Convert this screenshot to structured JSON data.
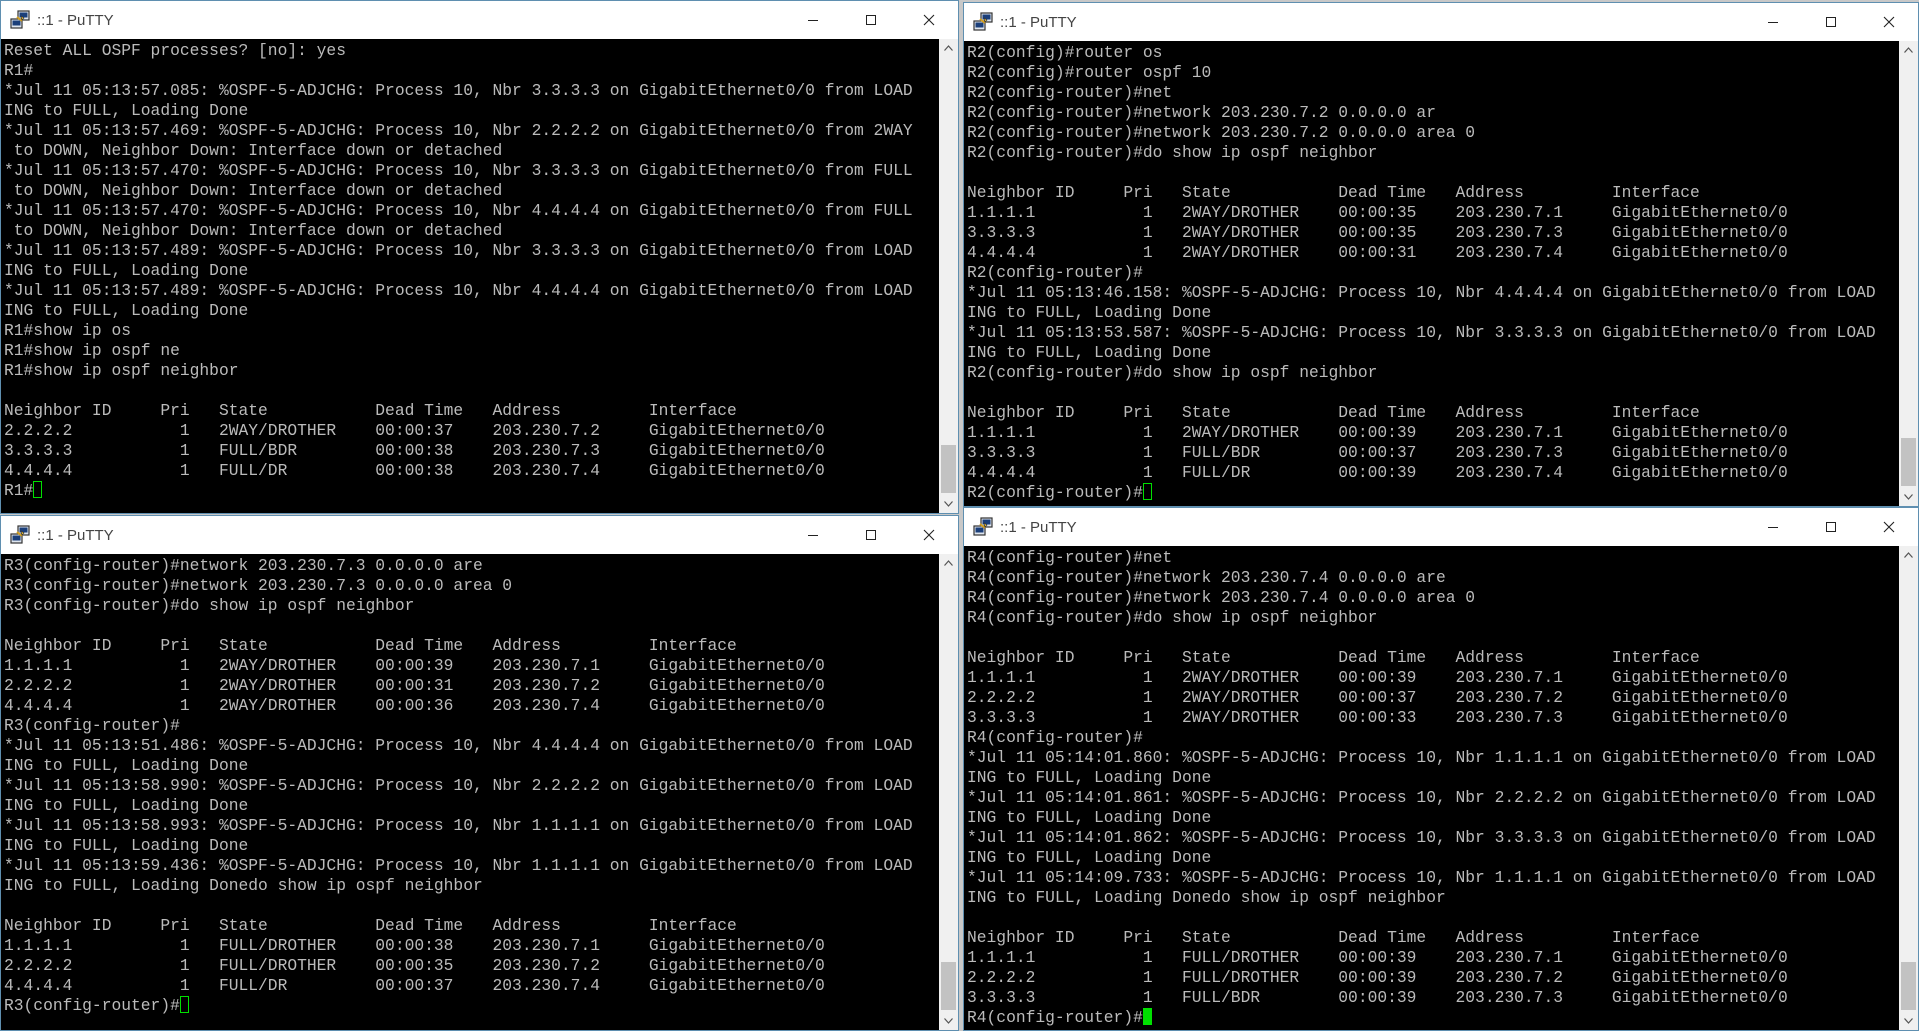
{
  "windows": [
    {
      "title": "::1 - PuTTY",
      "lines": [
        "Reset ALL OSPF processes? [no]: yes",
        "R1#",
        "*Jul 11 05:13:57.085: %OSPF-5-ADJCHG: Process 10, Nbr 3.3.3.3 on GigabitEthernet0/0 from LOAD",
        "ING to FULL, Loading Done",
        "*Jul 11 05:13:57.469: %OSPF-5-ADJCHG: Process 10, Nbr 2.2.2.2 on GigabitEthernet0/0 from 2WAY",
        " to DOWN, Neighbor Down: Interface down or detached",
        "*Jul 11 05:13:57.470: %OSPF-5-ADJCHG: Process 10, Nbr 3.3.3.3 on GigabitEthernet0/0 from FULL",
        " to DOWN, Neighbor Down: Interface down or detached",
        "*Jul 11 05:13:57.470: %OSPF-5-ADJCHG: Process 10, Nbr 4.4.4.4 on GigabitEthernet0/0 from FULL",
        " to DOWN, Neighbor Down: Interface down or detached",
        "*Jul 11 05:13:57.489: %OSPF-5-ADJCHG: Process 10, Nbr 3.3.3.3 on GigabitEthernet0/0 from LOAD",
        "ING to FULL, Loading Done",
        "*Jul 11 05:13:57.489: %OSPF-5-ADJCHG: Process 10, Nbr 4.4.4.4 on GigabitEthernet0/0 from LOAD",
        "ING to FULL, Loading Done",
        "R1#show ip os",
        "R1#show ip ospf ne",
        "R1#show ip ospf neighbor",
        "",
        "Neighbor ID     Pri   State           Dead Time   Address         Interface",
        "2.2.2.2           1   2WAY/DROTHER    00:00:37    203.230.7.2     GigabitEthernet0/0",
        "3.3.3.3           1   FULL/BDR        00:00:38    203.230.7.3     GigabitEthernet0/0",
        "4.4.4.4           1   FULL/DR         00:00:38    203.230.7.4     GigabitEthernet0/0",
        "R1#"
      ],
      "cursor": "outline"
    },
    {
      "title": "::1 - PuTTY",
      "lines": [
        "R2(config)#router os",
        "R2(config)#router ospf 10",
        "R2(config-router)#net",
        "R2(config-router)#network 203.230.7.2 0.0.0.0 ar",
        "R2(config-router)#network 203.230.7.2 0.0.0.0 area 0",
        "R2(config-router)#do show ip ospf neighbor",
        "",
        "Neighbor ID     Pri   State           Dead Time   Address         Interface",
        "1.1.1.1           1   2WAY/DROTHER    00:00:35    203.230.7.1     GigabitEthernet0/0",
        "3.3.3.3           1   2WAY/DROTHER    00:00:35    203.230.7.3     GigabitEthernet0/0",
        "4.4.4.4           1   2WAY/DROTHER    00:00:31    203.230.7.4     GigabitEthernet0/0",
        "R2(config-router)#",
        "*Jul 11 05:13:46.158: %OSPF-5-ADJCHG: Process 10, Nbr 4.4.4.4 on GigabitEthernet0/0 from LOAD",
        "ING to FULL, Loading Done",
        "*Jul 11 05:13:53.587: %OSPF-5-ADJCHG: Process 10, Nbr 3.3.3.3 on GigabitEthernet0/0 from LOAD",
        "ING to FULL, Loading Done",
        "R2(config-router)#do show ip ospf neighbor",
        "",
        "Neighbor ID     Pri   State           Dead Time   Address         Interface",
        "1.1.1.1           1   2WAY/DROTHER    00:00:39    203.230.7.1     GigabitEthernet0/0",
        "3.3.3.3           1   FULL/BDR        00:00:37    203.230.7.3     GigabitEthernet0/0",
        "4.4.4.4           1   FULL/DR         00:00:39    203.230.7.4     GigabitEthernet0/0",
        "R2(config-router)#"
      ],
      "cursor": "outline"
    },
    {
      "title": "::1 - PuTTY",
      "lines": [
        "R3(config-router)#network 203.230.7.3 0.0.0.0 are",
        "R3(config-router)#network 203.230.7.3 0.0.0.0 area 0",
        "R3(config-router)#do show ip ospf neighbor",
        "",
        "Neighbor ID     Pri   State           Dead Time   Address         Interface",
        "1.1.1.1           1   2WAY/DROTHER    00:00:39    203.230.7.1     GigabitEthernet0/0",
        "2.2.2.2           1   2WAY/DROTHER    00:00:31    203.230.7.2     GigabitEthernet0/0",
        "4.4.4.4           1   2WAY/DROTHER    00:00:36    203.230.7.4     GigabitEthernet0/0",
        "R3(config-router)#",
        "*Jul 11 05:13:51.486: %OSPF-5-ADJCHG: Process 10, Nbr 4.4.4.4 on GigabitEthernet0/0 from LOAD",
        "ING to FULL, Loading Done",
        "*Jul 11 05:13:58.990: %OSPF-5-ADJCHG: Process 10, Nbr 2.2.2.2 on GigabitEthernet0/0 from LOAD",
        "ING to FULL, Loading Done",
        "*Jul 11 05:13:58.993: %OSPF-5-ADJCHG: Process 10, Nbr 1.1.1.1 on GigabitEthernet0/0 from LOAD",
        "ING to FULL, Loading Done",
        "*Jul 11 05:13:59.436: %OSPF-5-ADJCHG: Process 10, Nbr 1.1.1.1 on GigabitEthernet0/0 from LOAD",
        "ING to FULL, Loading Donedo show ip ospf neighbor",
        "",
        "Neighbor ID     Pri   State           Dead Time   Address         Interface",
        "1.1.1.1           1   FULL/DROTHER    00:00:38    203.230.7.1     GigabitEthernet0/0",
        "2.2.2.2           1   FULL/DROTHER    00:00:35    203.230.7.2     GigabitEthernet0/0",
        "4.4.4.4           1   FULL/DR         00:00:37    203.230.7.4     GigabitEthernet0/0",
        "R3(config-router)#"
      ],
      "cursor": "outline"
    },
    {
      "title": "::1 - PuTTY",
      "lines": [
        "R4(config-router)#net",
        "R4(config-router)#network 203.230.7.4 0.0.0.0 are",
        "R4(config-router)#network 203.230.7.4 0.0.0.0 area 0",
        "R4(config-router)#do show ip ospf neighbor",
        "",
        "Neighbor ID     Pri   State           Dead Time   Address         Interface",
        "1.1.1.1           1   2WAY/DROTHER    00:00:39    203.230.7.1     GigabitEthernet0/0",
        "2.2.2.2           1   2WAY/DROTHER    00:00:37    203.230.7.2     GigabitEthernet0/0",
        "3.3.3.3           1   2WAY/DROTHER    00:00:33    203.230.7.3     GigabitEthernet0/0",
        "R4(config-router)#",
        "*Jul 11 05:14:01.860: %OSPF-5-ADJCHG: Process 10, Nbr 1.1.1.1 on GigabitEthernet0/0 from LOAD",
        "ING to FULL, Loading Done",
        "*Jul 11 05:14:01.861: %OSPF-5-ADJCHG: Process 10, Nbr 2.2.2.2 on GigabitEthernet0/0 from LOAD",
        "ING to FULL, Loading Done",
        "*Jul 11 05:14:01.862: %OSPF-5-ADJCHG: Process 10, Nbr 3.3.3.3 on GigabitEthernet0/0 from LOAD",
        "ING to FULL, Loading Done",
        "*Jul 11 05:14:09.733: %OSPF-5-ADJCHG: Process 10, Nbr 1.1.1.1 on GigabitEthernet0/0 from LOAD",
        "ING to FULL, Loading Donedo show ip ospf neighbor",
        "",
        "Neighbor ID     Pri   State           Dead Time   Address         Interface",
        "1.1.1.1           1   FULL/DROTHER    00:00:39    203.230.7.1     GigabitEthernet0/0",
        "2.2.2.2           1   FULL/DROTHER    00:00:39    203.230.7.2     GigabitEthernet0/0",
        "3.3.3.3           1   FULL/BDR        00:00:39    203.230.7.3     GigabitEthernet0/0",
        "R4(config-router)#"
      ],
      "cursor": "solid"
    }
  ],
  "colors": {
    "terminal_bg": "#000000",
    "terminal_fg": "#bbbbbb",
    "cursor": "#00e000",
    "window_border": "#5f8fb0"
  },
  "icons": {
    "app": "putty-icon",
    "minimize": "minimize-icon",
    "maximize": "maximize-icon",
    "close": "close-icon"
  }
}
